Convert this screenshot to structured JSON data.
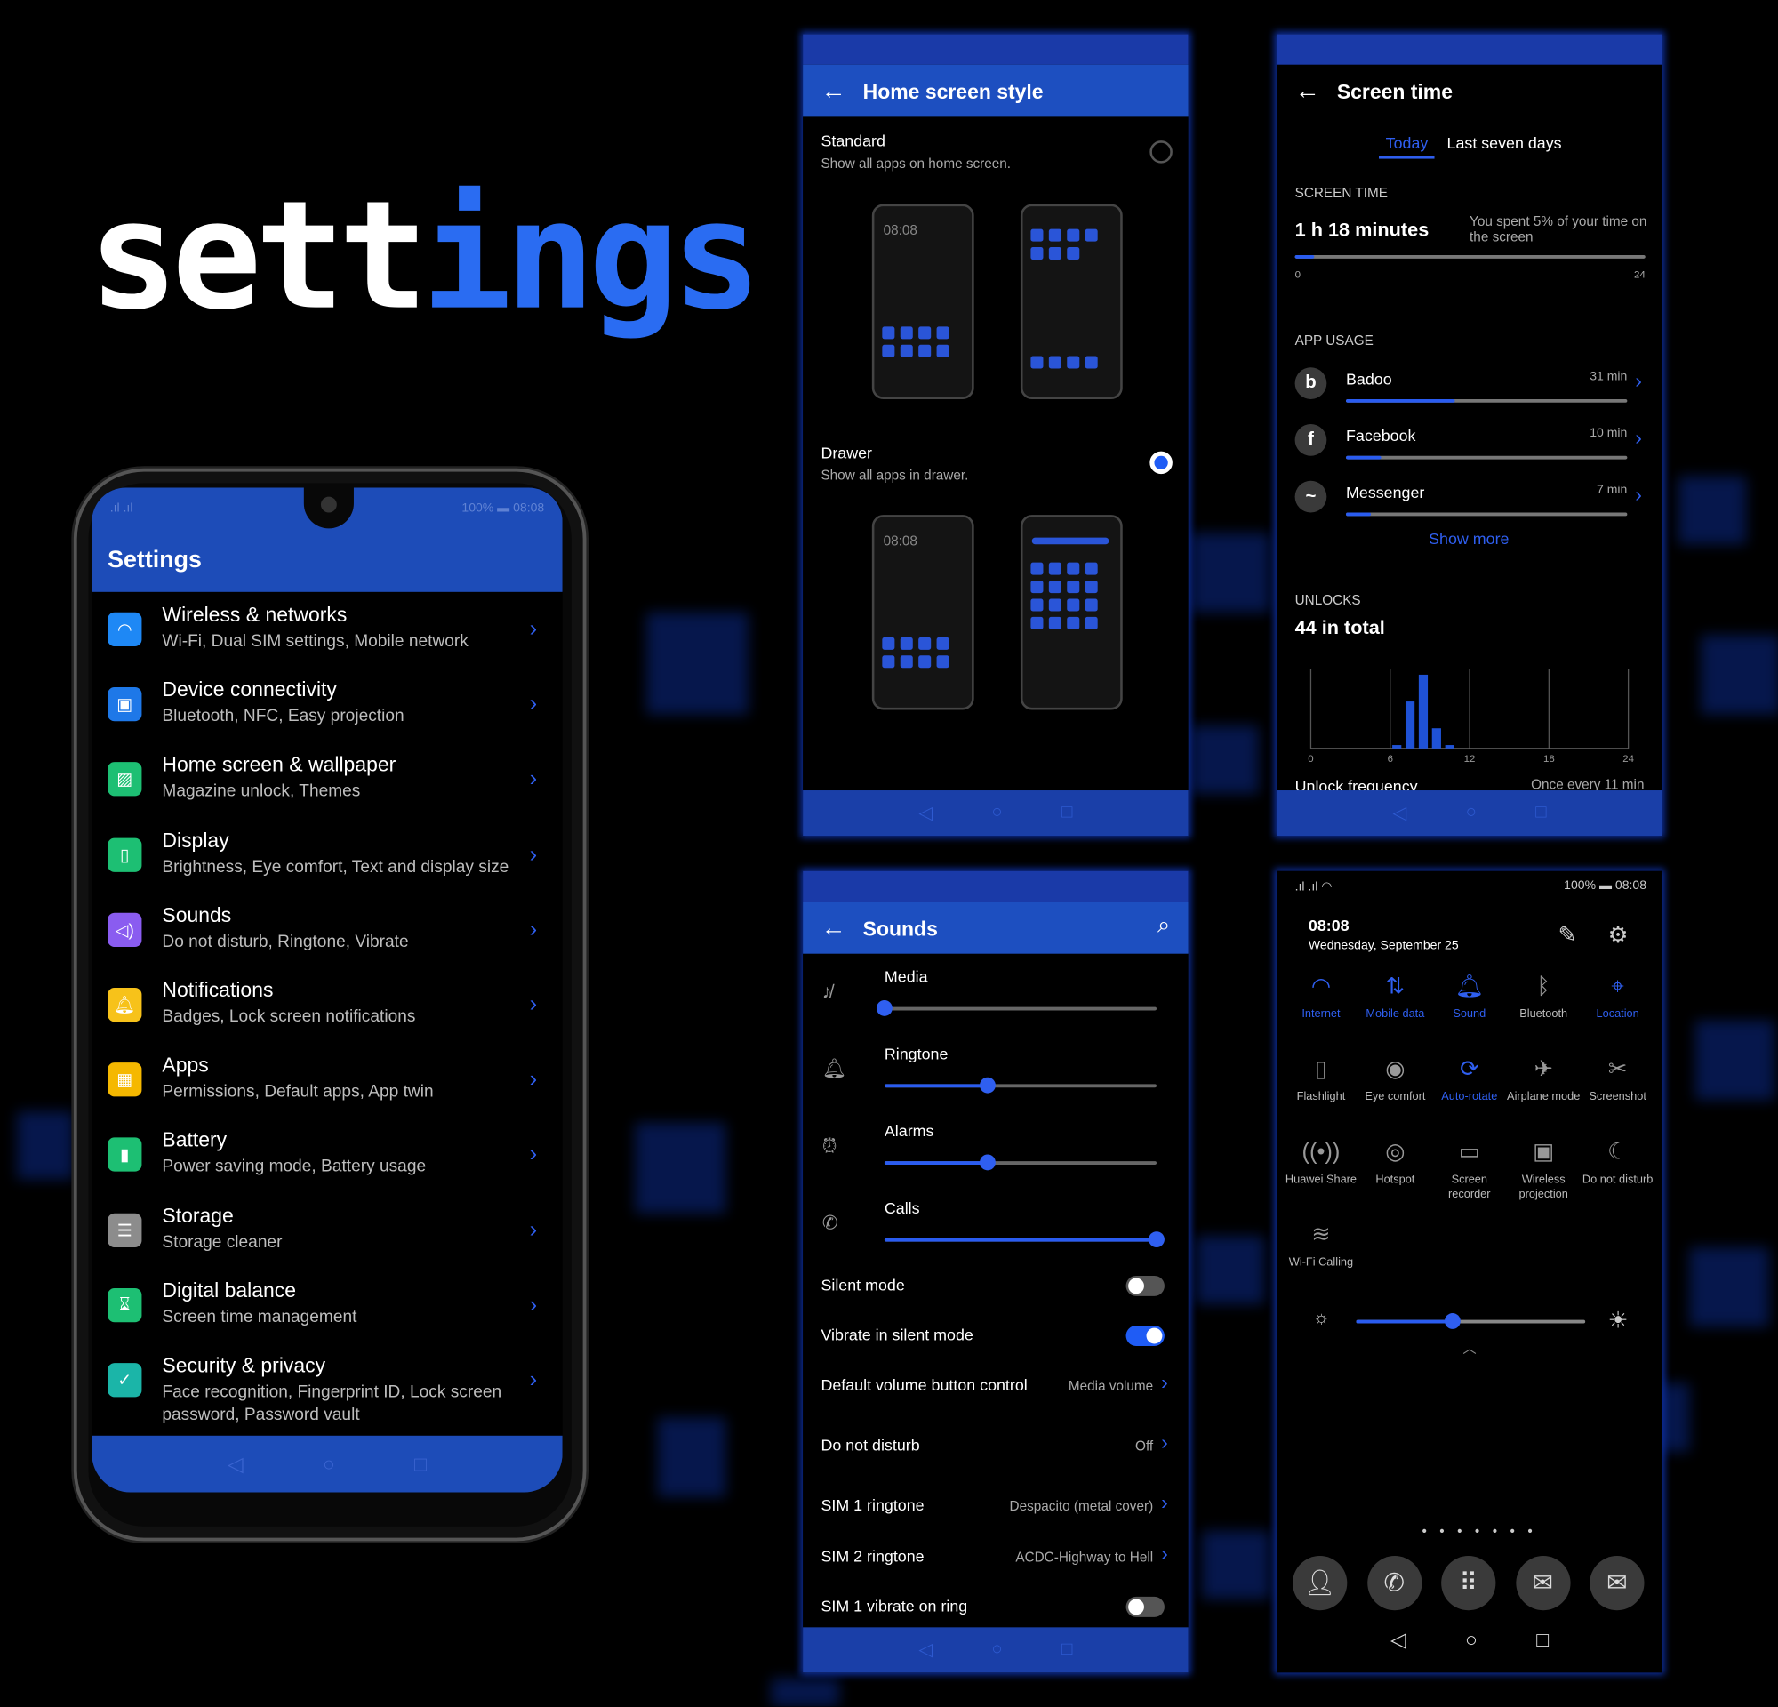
{
  "logo": {
    "part1": "sett",
    "part2": "ings"
  },
  "colors": {
    "accent": "#2a5cf0",
    "header": "#1d4cb8",
    "background": "#000000"
  },
  "status": {
    "battery": "100%",
    "time": "08:08"
  },
  "settings_screen": {
    "title": "Settings",
    "items": [
      {
        "title": "Wireless & networks",
        "subtitle": "Wi-Fi, Dual SIM settings, Mobile network",
        "icon": "wifi-icon",
        "color": "#1e88f5"
      },
      {
        "title": "Device connectivity",
        "subtitle": "Bluetooth, NFC, Easy projection",
        "icon": "device-connectivity-icon",
        "color": "#1e78e8"
      },
      {
        "title": "Home screen & wallpaper",
        "subtitle": "Magazine unlock, Themes",
        "icon": "wallpaper-icon",
        "color": "#1dbf73"
      },
      {
        "title": "Display",
        "subtitle": "Brightness, Eye comfort, Text and display size",
        "icon": "display-icon",
        "color": "#1dbf73"
      },
      {
        "title": "Sounds",
        "subtitle": "Do not disturb, Ringtone, Vibrate",
        "icon": "speaker-icon",
        "color": "#8a5cf0"
      },
      {
        "title": "Notifications",
        "subtitle": "Badges, Lock screen notifications",
        "icon": "bell-icon",
        "color": "#f7c21a"
      },
      {
        "title": "Apps",
        "subtitle": "Permissions, Default apps, App twin",
        "icon": "apps-icon",
        "color": "#f5b800"
      },
      {
        "title": "Battery",
        "subtitle": "Power saving mode, Battery usage",
        "icon": "battery-icon",
        "color": "#1dbf73"
      },
      {
        "title": "Storage",
        "subtitle": "Storage cleaner",
        "icon": "storage-icon",
        "color": "#8c8c8c"
      },
      {
        "title": "Digital balance",
        "subtitle": "Screen time management",
        "icon": "hourglass-icon",
        "color": "#1dbf73"
      },
      {
        "title": "Security & privacy",
        "subtitle": "Face recognition, Fingerprint ID, Lock screen password, Password vault",
        "icon": "shield-icon",
        "color": "#1bb5a8"
      }
    ]
  },
  "home_style": {
    "title": "Home screen style",
    "options": [
      {
        "label": "Standard",
        "desc": "Show all apps on home screen.",
        "selected": false
      },
      {
        "label": "Drawer",
        "desc": "Show all apps in drawer.",
        "selected": true
      }
    ],
    "mock_time": "08:08"
  },
  "screen_time": {
    "title": "Screen time",
    "tabs": [
      "Today",
      "Last seven days"
    ],
    "active_tab": "Today",
    "section_screen": "SCREEN TIME",
    "total": "1 h 18 minutes",
    "note": "You spent 5% of your time on the screen",
    "progress_hours": 1.3,
    "axis_min": "0",
    "axis_max": "24",
    "section_apps": "APP USAGE",
    "apps": [
      {
        "name": "Badoo",
        "time": "31 min",
        "minutes": 31,
        "icon": "badoo-icon",
        "glyph": "b"
      },
      {
        "name": "Facebook",
        "time": "10 min",
        "minutes": 10,
        "icon": "facebook-icon",
        "glyph": "f"
      },
      {
        "name": "Messenger",
        "time": "7 min",
        "minutes": 7,
        "icon": "messenger-icon",
        "glyph": "~"
      }
    ],
    "show_more": "Show more",
    "section_unlocks": "UNLOCKS",
    "unlocks_total": "44 in total",
    "freq_label": "Unlock frequency",
    "freq_value": "Once every 11 min"
  },
  "chart_data": {
    "type": "bar",
    "x": [
      6,
      7,
      8,
      9,
      10
    ],
    "values": [
      1,
      14,
      22,
      6,
      1
    ],
    "xlim": [
      0,
      24
    ],
    "xticks": [
      "0",
      "6",
      "12",
      "18",
      "24"
    ],
    "grid": true
  },
  "sounds": {
    "title": "Sounds",
    "sliders": [
      {
        "label": "Media",
        "value": 0.0,
        "icon": "media-muted-icon"
      },
      {
        "label": "Ringtone",
        "value": 0.38,
        "icon": "bell-icon"
      },
      {
        "label": "Alarms",
        "value": 0.38,
        "icon": "alarm-icon"
      },
      {
        "label": "Calls",
        "value": 1.0,
        "icon": "phone-icon"
      }
    ],
    "toggles": [
      {
        "label": "Silent mode",
        "on": false
      },
      {
        "label": "Vibrate in silent mode",
        "on": true
      }
    ],
    "rows": [
      {
        "label": "Default volume button control",
        "value": "Media volume"
      },
      {
        "label": "Do not disturb",
        "value": "Off"
      },
      {
        "label": "SIM 1 ringtone",
        "value": "Despacito (metal cover)"
      },
      {
        "label": "SIM 2 ringtone",
        "value": "ACDC-Highway to Hell"
      }
    ],
    "last_toggle": {
      "label": "SIM 1 vibrate on ring",
      "on": false
    }
  },
  "notification_panel": {
    "time": "08:08",
    "date": "Wednesday, September 25",
    "tiles": [
      {
        "label": "Internet",
        "active": true,
        "glyph": "◠"
      },
      {
        "label": "Mobile data",
        "active": true,
        "glyph": "⇅"
      },
      {
        "label": "Sound",
        "active": true,
        "glyph": "🔔︎"
      },
      {
        "label": "Bluetooth",
        "active": false,
        "glyph": "ᛒ"
      },
      {
        "label": "Location",
        "active": true,
        "glyph": "⌖"
      },
      {
        "label": "Flashlight",
        "active": false,
        "glyph": "▯"
      },
      {
        "label": "Eye comfort",
        "active": false,
        "glyph": "◉"
      },
      {
        "label": "Auto-rotate",
        "active": true,
        "glyph": "⟳"
      },
      {
        "label": "Airplane mode",
        "active": false,
        "glyph": "✈"
      },
      {
        "label": "Screenshot",
        "active": false,
        "glyph": "✂"
      },
      {
        "label": "Huawei Share",
        "active": false,
        "glyph": "((•))"
      },
      {
        "label": "Hotspot",
        "active": false,
        "glyph": "◎"
      },
      {
        "label": "Screen recorder",
        "active": false,
        "glyph": "▭"
      },
      {
        "label": "Wireless projection",
        "active": false,
        "glyph": "▣"
      },
      {
        "label": "Do not disturb",
        "active": false,
        "glyph": "☾"
      },
      {
        "label": "Wi-Fi Calling",
        "active": false,
        "glyph": "≋"
      }
    ],
    "brightness": 0.42,
    "dock": [
      {
        "name": "contacts-icon",
        "glyph": "👤︎"
      },
      {
        "name": "phone-icon",
        "glyph": "✆"
      },
      {
        "name": "app-drawer-icon",
        "glyph": "⠿"
      },
      {
        "name": "messages-icon",
        "glyph": "✉"
      },
      {
        "name": "email-icon",
        "glyph": "✉"
      }
    ]
  }
}
